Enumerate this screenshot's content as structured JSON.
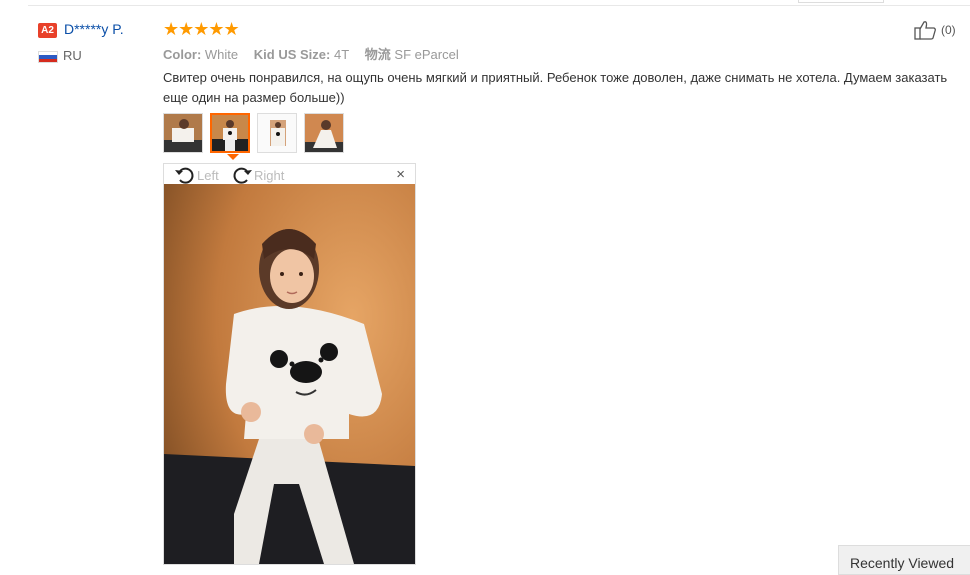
{
  "reviewer": {
    "badge": "A2",
    "name": "D*****y P.",
    "country": "RU"
  },
  "rating": {
    "stars": "★★★★★",
    "value": 5,
    "max": 5
  },
  "attributes": [
    {
      "key": "Color:",
      "value": "White"
    },
    {
      "key": "Kid US Size:",
      "value": "4T"
    },
    {
      "key": "物流",
      "value": "SF eParcel"
    }
  ],
  "review_text": "Свитер очень понравился, на ощупь очень мягкий и приятный. Ребенок тоже доволен, даже снимать не хотела. Думаем заказать еще один на размер больше))",
  "viewer": {
    "rotate_left": "Left",
    "rotate_right": "Right",
    "close": "×"
  },
  "helpful": {
    "count": "(0)"
  },
  "recently_viewed": "Recently Viewed",
  "colors": {
    "accent": "#ff6600",
    "star": "#ff9a00",
    "link": "#0b4fa8",
    "badge": "#e8412a"
  }
}
